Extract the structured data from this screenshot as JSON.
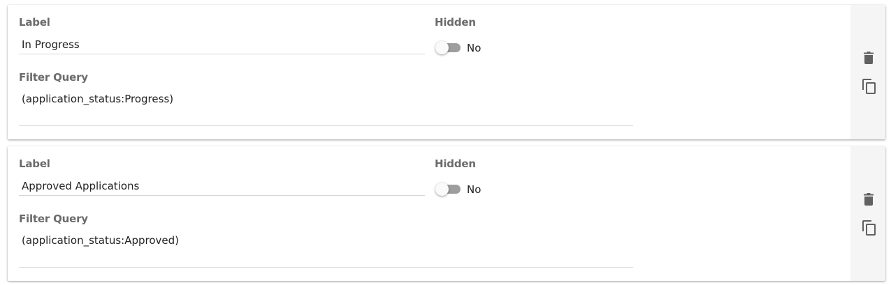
{
  "rows": [
    {
      "label_heading": "Label",
      "label_value": "In Progress",
      "hidden_heading": "Hidden",
      "hidden_state": "No",
      "hidden_on": false,
      "query_heading": "Filter Query",
      "query_value": "(application_status:Progress)",
      "delete_icon": "trash-icon",
      "copy_icon": "copy-icon"
    },
    {
      "label_heading": "Label",
      "label_value": "Approved Applications",
      "hidden_heading": "Hidden",
      "hidden_state": "No",
      "hidden_on": false,
      "query_heading": "Filter Query",
      "query_value": "(application_status:Approved)",
      "delete_icon": "trash-icon",
      "copy_icon": "copy-icon"
    }
  ],
  "colors": {
    "heading": "#6b6b6b",
    "text": "#222222",
    "underline": "#d6d6d6",
    "toggle_track_off": "#9e9e9e",
    "side_panel": "#f5f5f5",
    "icon": "#616161"
  }
}
